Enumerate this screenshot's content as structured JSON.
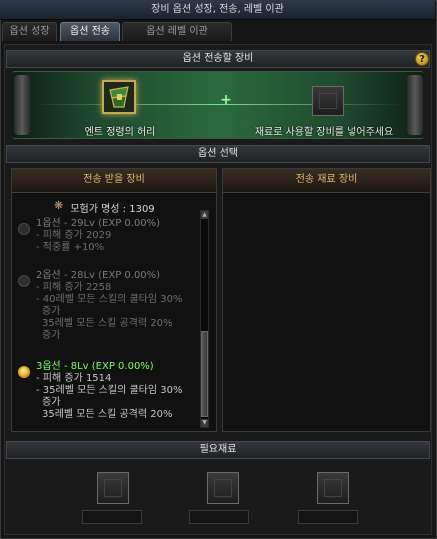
{
  "window": {
    "title": "장비 옵션 성장, 전송, 레벨 이관"
  },
  "tabs": [
    {
      "label": "옵션 성장",
      "active": false
    },
    {
      "label": "옵션 전송",
      "active": true
    },
    {
      "label": "옵션 레벨 이관",
      "active": false
    }
  ],
  "transfer": {
    "header": "옵션 전송할 장비",
    "help_label": "?",
    "source_item_name": "엔트 정령의 허리",
    "plus_symbol": "+",
    "target_hint": "재료로 사용할 장비를 넣어주세요"
  },
  "option_select": {
    "header": "옵션 선택",
    "receive_title": "전송 받을 장비",
    "material_title": "전송 재료 장비",
    "reputation": "모험가 명성 : 1309",
    "options": [
      {
        "title": "1옵션 - 29Lv (EXP 0.00%)",
        "details": [
          "- 피해 증가 2029",
          "- 적중률 +10%"
        ],
        "selected": false
      },
      {
        "title": "2옵션 - 28Lv (EXP 0.00%)",
        "details": [
          "- 피해 증가 2258",
          "- 40레벨 모든 스킬의 쿨타임 30%",
          "증가",
          "35레벨 모든 스킬 공격력 20%",
          "증가"
        ],
        "selected": false
      },
      {
        "title": "3옵션 - 8Lv (EXP 0.00%)",
        "details": [
          "- 피해 증가 1514",
          "- 35레벨 모든 스킬의 쿨타임 30%",
          "증가",
          "35레벨 모든 스킬 공격력 20%"
        ],
        "selected": true
      }
    ]
  },
  "materials": {
    "header": "필요재료"
  },
  "colors": {
    "selected_option": "#7aff5a",
    "box_title": "#e2b870",
    "source_slot_border": "#c9a852",
    "band_green": "#2a6a3e"
  },
  "icons": {
    "help": "question-icon",
    "reputation": "reputation-icon",
    "source_item": "belt-item-icon"
  }
}
